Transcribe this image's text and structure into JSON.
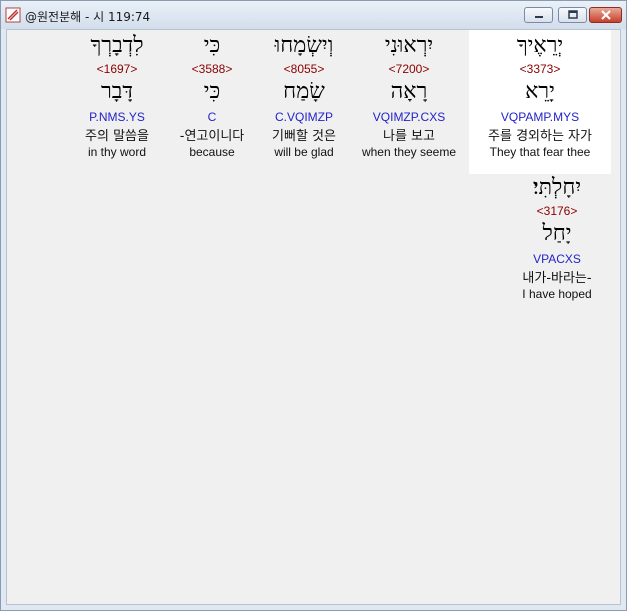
{
  "window": {
    "title": "@원전분해 - 시 119:74",
    "buttons": {
      "minimize": "minimize-icon",
      "maximize": "maximize-icon",
      "close": "close-icon"
    }
  },
  "words": [
    {
      "hebrew": "לִדְבָרְךָ",
      "strong": "<1697>",
      "lemma": "דָּבָר",
      "morph": "P.NMS.YS",
      "korean": "주의 말씀을",
      "english": "in thy word"
    },
    {
      "hebrew": "כִּי",
      "strong": "<3588>",
      "lemma": "כִּי",
      "morph": "C",
      "korean": "-연고이니다",
      "english": "because"
    },
    {
      "hebrew": "וְיִשְׂמָחוּ",
      "strong": "<8055>",
      "lemma": "שָׂמַח",
      "morph": "C.VQIMZP",
      "korean": "기뻐할 것은",
      "english": "will be glad"
    },
    {
      "hebrew": "יִרְאוּנִי",
      "strong": "<7200>",
      "lemma": "רָאָה",
      "morph": "VQIMZP.CXS",
      "korean": "나를 보고",
      "english": "when they seeme"
    },
    {
      "hebrew": "יְרֵאֶיךָ",
      "strong": "<3373>",
      "lemma": "יָרֵא",
      "morph": "VQPAMP.MYS",
      "korean": "주를 경외하는 자가",
      "english": "They that fear thee"
    },
    {
      "hebrew": "יִחָלְתִּי׃",
      "strong": "<3176>",
      "lemma": "יָחַל",
      "morph": "VPACXS",
      "korean": "내가-바라는-",
      "english": "I have hoped"
    }
  ]
}
